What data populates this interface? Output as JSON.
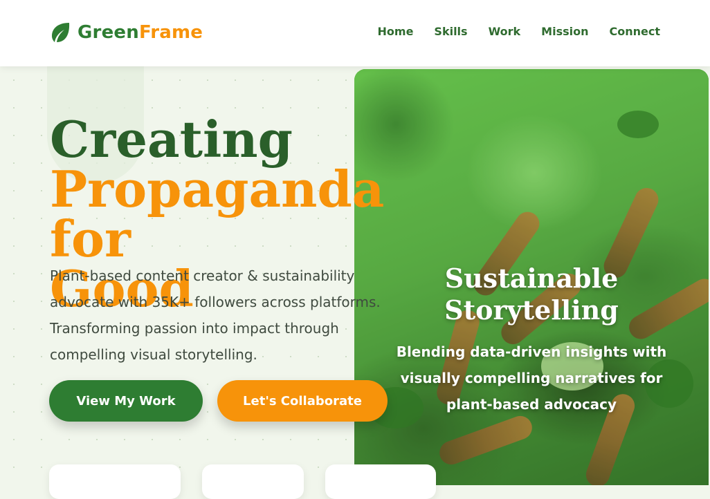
{
  "brand": {
    "part1": "Green",
    "part2": "Frame",
    "icon": "leaf-icon"
  },
  "nav": {
    "items": [
      "Home",
      "Skills",
      "Work",
      "Mission",
      "Connect"
    ]
  },
  "hero": {
    "title_line1": "Creating",
    "title_line2": "Propaganda for",
    "title_line3": "Good",
    "description": "Plant-based content creator & sustainability advocate with 35K+ followers across platforms. Transforming passion into impact through compelling visual storytelling.",
    "primary_button": "View My Work",
    "secondary_button": "Let's Collaborate"
  },
  "card": {
    "title_line1": "Sustainable",
    "title_line2": "Storytelling",
    "text": "Blending data-driven insights with visually compelling narratives for plant-based advocacy"
  },
  "colors": {
    "green": "#2e7d32",
    "orange": "#f7930a",
    "background": "#f1f6ec"
  }
}
